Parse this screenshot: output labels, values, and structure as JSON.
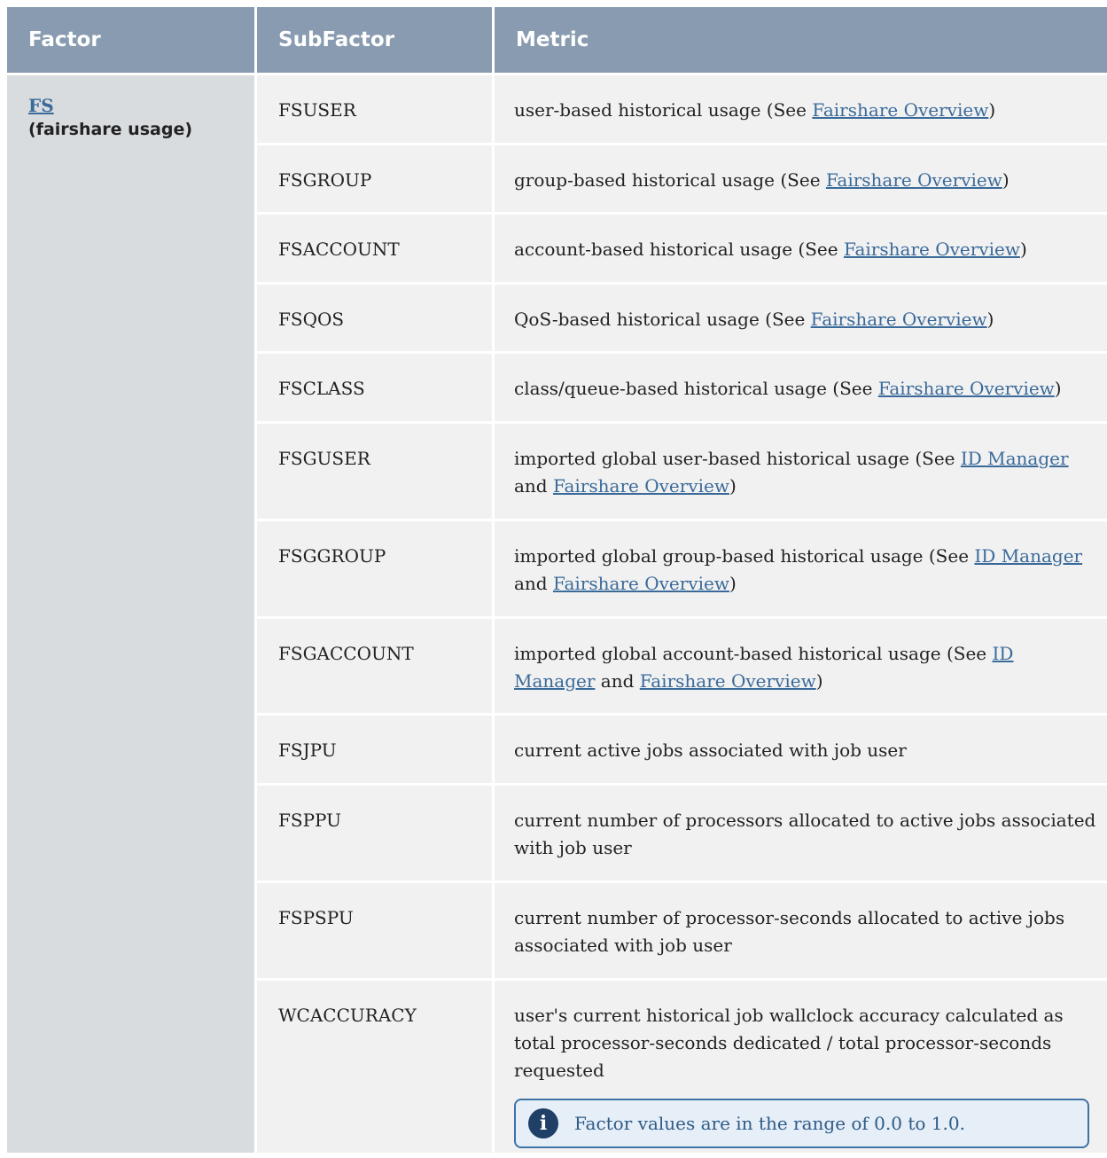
{
  "headers": [
    "Factor",
    "SubFactor",
    "Metric"
  ],
  "factor": {
    "link": "FS",
    "desc": "(fairshare usage)"
  },
  "rows": [
    {
      "sub": "FSUSER",
      "metric": [
        {
          "t": "user-based historical usage (See "
        },
        {
          "t": "Fairshare Overview",
          "link": true
        },
        {
          "t": ")"
        }
      ]
    },
    {
      "sub": "FSGROUP",
      "metric": [
        {
          "t": "group-based historical usage (See "
        },
        {
          "t": "Fairshare Overview",
          "link": true
        },
        {
          "t": ")"
        }
      ]
    },
    {
      "sub": "FSACCOUNT",
      "metric": [
        {
          "t": "account-based historical usage (See "
        },
        {
          "t": "Fairshare Overview",
          "link": true
        },
        {
          "t": ")"
        }
      ]
    },
    {
      "sub": "FSQOS",
      "metric": [
        {
          "t": "QoS-based historical usage (See "
        },
        {
          "t": "Fairshare Overview",
          "link": true
        },
        {
          "t": ")"
        }
      ]
    },
    {
      "sub": "FSCLASS",
      "metric": [
        {
          "t": "class/queue-based historical usage (See "
        },
        {
          "t": "Fairshare Overview",
          "link": true
        },
        {
          "t": ")"
        }
      ]
    },
    {
      "sub": "FSGUSER",
      "metric": [
        {
          "t": "imported global user-based historical usage (See "
        },
        {
          "t": "ID Manager",
          "link": true
        },
        {
          "t": " and "
        },
        {
          "t": "Fairshare Overview",
          "link": true
        },
        {
          "t": ")"
        }
      ]
    },
    {
      "sub": "FSGGROUP",
      "metric": [
        {
          "t": "imported global group-based historical usage (See "
        },
        {
          "t": "ID Manager",
          "link": true
        },
        {
          "t": " and "
        },
        {
          "t": "Fairshare Overview",
          "link": true
        },
        {
          "t": ")"
        }
      ]
    },
    {
      "sub": "FSGACCOUNT",
      "metric": [
        {
          "t": "imported global account-based historical usage (See "
        },
        {
          "t": "ID Manager",
          "link": true
        },
        {
          "t": " and "
        },
        {
          "t": "Fairshare Overview",
          "link": true
        },
        {
          "t": ")"
        }
      ]
    },
    {
      "sub": "FSJPU",
      "metric": [
        {
          "t": "current active jobs associated with job user"
        }
      ]
    },
    {
      "sub": "FSPPU",
      "metric": [
        {
          "t": "current number of processors allocated to active jobs associated with job user"
        }
      ]
    },
    {
      "sub": "FSPSPU",
      "metric": [
        {
          "t": "current number of processor-seconds allocated to active jobs associated with job user"
        }
      ]
    },
    {
      "sub": "WCACCURACY",
      "metric": [
        {
          "t": "user's current historical job wallclock accuracy calculated as total processor-seconds dedicated / total processor-seconds requested"
        }
      ]
    }
  ],
  "note": {
    "icon": "info-icon",
    "text": "Factor values are in the range of 0.0 to 1.0."
  }
}
